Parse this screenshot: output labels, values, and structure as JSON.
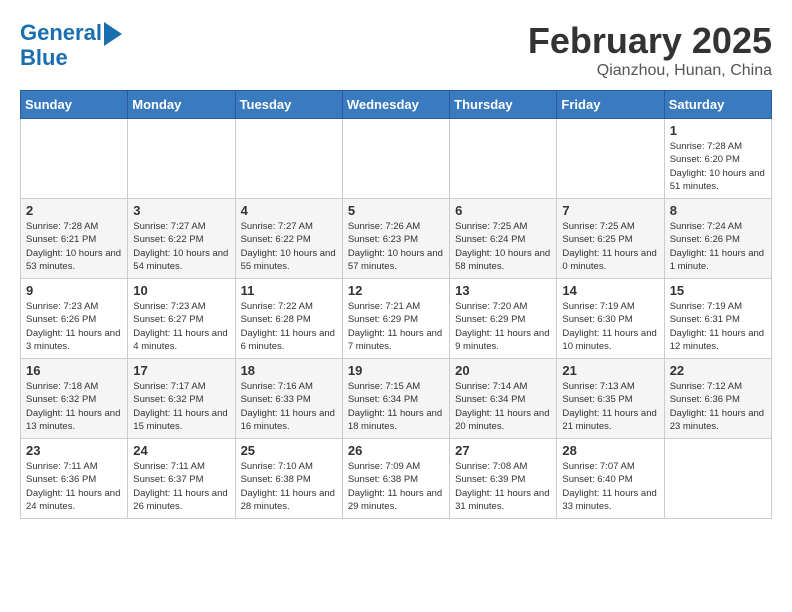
{
  "header": {
    "logo_line1": "General",
    "logo_line2": "Blue",
    "month": "February 2025",
    "location": "Qianzhou, Hunan, China"
  },
  "days_of_week": [
    "Sunday",
    "Monday",
    "Tuesday",
    "Wednesday",
    "Thursday",
    "Friday",
    "Saturday"
  ],
  "weeks": [
    [
      {
        "day": "",
        "info": ""
      },
      {
        "day": "",
        "info": ""
      },
      {
        "day": "",
        "info": ""
      },
      {
        "day": "",
        "info": ""
      },
      {
        "day": "",
        "info": ""
      },
      {
        "day": "",
        "info": ""
      },
      {
        "day": "1",
        "info": "Sunrise: 7:28 AM\nSunset: 6:20 PM\nDaylight: 10 hours and 51 minutes."
      }
    ],
    [
      {
        "day": "2",
        "info": "Sunrise: 7:28 AM\nSunset: 6:21 PM\nDaylight: 10 hours and 53 minutes."
      },
      {
        "day": "3",
        "info": "Sunrise: 7:27 AM\nSunset: 6:22 PM\nDaylight: 10 hours and 54 minutes."
      },
      {
        "day": "4",
        "info": "Sunrise: 7:27 AM\nSunset: 6:22 PM\nDaylight: 10 hours and 55 minutes."
      },
      {
        "day": "5",
        "info": "Sunrise: 7:26 AM\nSunset: 6:23 PM\nDaylight: 10 hours and 57 minutes."
      },
      {
        "day": "6",
        "info": "Sunrise: 7:25 AM\nSunset: 6:24 PM\nDaylight: 10 hours and 58 minutes."
      },
      {
        "day": "7",
        "info": "Sunrise: 7:25 AM\nSunset: 6:25 PM\nDaylight: 11 hours and 0 minutes."
      },
      {
        "day": "8",
        "info": "Sunrise: 7:24 AM\nSunset: 6:26 PM\nDaylight: 11 hours and 1 minute."
      }
    ],
    [
      {
        "day": "9",
        "info": "Sunrise: 7:23 AM\nSunset: 6:26 PM\nDaylight: 11 hours and 3 minutes."
      },
      {
        "day": "10",
        "info": "Sunrise: 7:23 AM\nSunset: 6:27 PM\nDaylight: 11 hours and 4 minutes."
      },
      {
        "day": "11",
        "info": "Sunrise: 7:22 AM\nSunset: 6:28 PM\nDaylight: 11 hours and 6 minutes."
      },
      {
        "day": "12",
        "info": "Sunrise: 7:21 AM\nSunset: 6:29 PM\nDaylight: 11 hours and 7 minutes."
      },
      {
        "day": "13",
        "info": "Sunrise: 7:20 AM\nSunset: 6:29 PM\nDaylight: 11 hours and 9 minutes."
      },
      {
        "day": "14",
        "info": "Sunrise: 7:19 AM\nSunset: 6:30 PM\nDaylight: 11 hours and 10 minutes."
      },
      {
        "day": "15",
        "info": "Sunrise: 7:19 AM\nSunset: 6:31 PM\nDaylight: 11 hours and 12 minutes."
      }
    ],
    [
      {
        "day": "16",
        "info": "Sunrise: 7:18 AM\nSunset: 6:32 PM\nDaylight: 11 hours and 13 minutes."
      },
      {
        "day": "17",
        "info": "Sunrise: 7:17 AM\nSunset: 6:32 PM\nDaylight: 11 hours and 15 minutes."
      },
      {
        "day": "18",
        "info": "Sunrise: 7:16 AM\nSunset: 6:33 PM\nDaylight: 11 hours and 16 minutes."
      },
      {
        "day": "19",
        "info": "Sunrise: 7:15 AM\nSunset: 6:34 PM\nDaylight: 11 hours and 18 minutes."
      },
      {
        "day": "20",
        "info": "Sunrise: 7:14 AM\nSunset: 6:34 PM\nDaylight: 11 hours and 20 minutes."
      },
      {
        "day": "21",
        "info": "Sunrise: 7:13 AM\nSunset: 6:35 PM\nDaylight: 11 hours and 21 minutes."
      },
      {
        "day": "22",
        "info": "Sunrise: 7:12 AM\nSunset: 6:36 PM\nDaylight: 11 hours and 23 minutes."
      }
    ],
    [
      {
        "day": "23",
        "info": "Sunrise: 7:11 AM\nSunset: 6:36 PM\nDaylight: 11 hours and 24 minutes."
      },
      {
        "day": "24",
        "info": "Sunrise: 7:11 AM\nSunset: 6:37 PM\nDaylight: 11 hours and 26 minutes."
      },
      {
        "day": "25",
        "info": "Sunrise: 7:10 AM\nSunset: 6:38 PM\nDaylight: 11 hours and 28 minutes."
      },
      {
        "day": "26",
        "info": "Sunrise: 7:09 AM\nSunset: 6:38 PM\nDaylight: 11 hours and 29 minutes."
      },
      {
        "day": "27",
        "info": "Sunrise: 7:08 AM\nSunset: 6:39 PM\nDaylight: 11 hours and 31 minutes."
      },
      {
        "day": "28",
        "info": "Sunrise: 7:07 AM\nSunset: 6:40 PM\nDaylight: 11 hours and 33 minutes."
      },
      {
        "day": "",
        "info": ""
      }
    ]
  ]
}
